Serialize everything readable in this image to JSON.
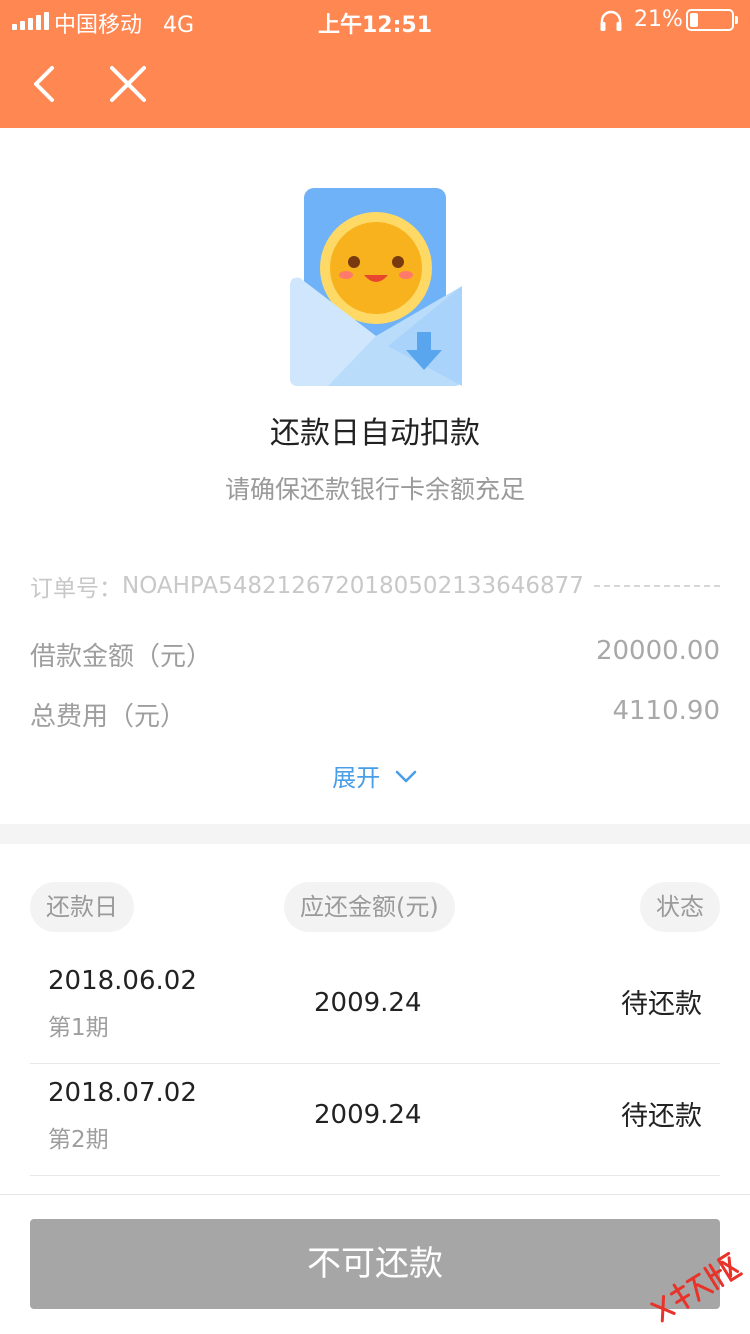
{
  "status_bar": {
    "carrier": "中国移动",
    "network": "4G",
    "time": "上午12:51",
    "battery_percent": "21%",
    "battery_level": 0.21
  },
  "nav": {
    "back_icon": "chevron-left-icon",
    "close_icon": "close-icon"
  },
  "hero": {
    "icon": "envelope-smiley-icon",
    "title": "还款日自动扣款",
    "subtitle": "请确保还款银行卡余额充足"
  },
  "order": {
    "label": "订单号：",
    "number": "NOAHPA548212672018050213364687​7"
  },
  "info": {
    "loan_label": "借款金额（元）",
    "loan_value": "20000.00",
    "fee_label": "总费用（元）",
    "fee_value": "4110.90"
  },
  "expand": {
    "label": "展开",
    "icon": "chevron-down-icon"
  },
  "table": {
    "headers": [
      "还款日",
      "应还金额(元)",
      "状态"
    ],
    "rows": [
      {
        "date": "2018.06.02",
        "period": "第1期",
        "amount": "2009.24",
        "status": "待还款"
      },
      {
        "date": "2018.07.02",
        "period": "第2期",
        "amount": "2009.24",
        "status": "待还款"
      }
    ]
  },
  "footer": {
    "button_label": "不可还款"
  },
  "watermark": {
    "text": "卡农社区"
  },
  "colors": {
    "header_bg": "#ff8752",
    "link": "#4a9ee8",
    "button_disabled": "#a6a6a6"
  }
}
